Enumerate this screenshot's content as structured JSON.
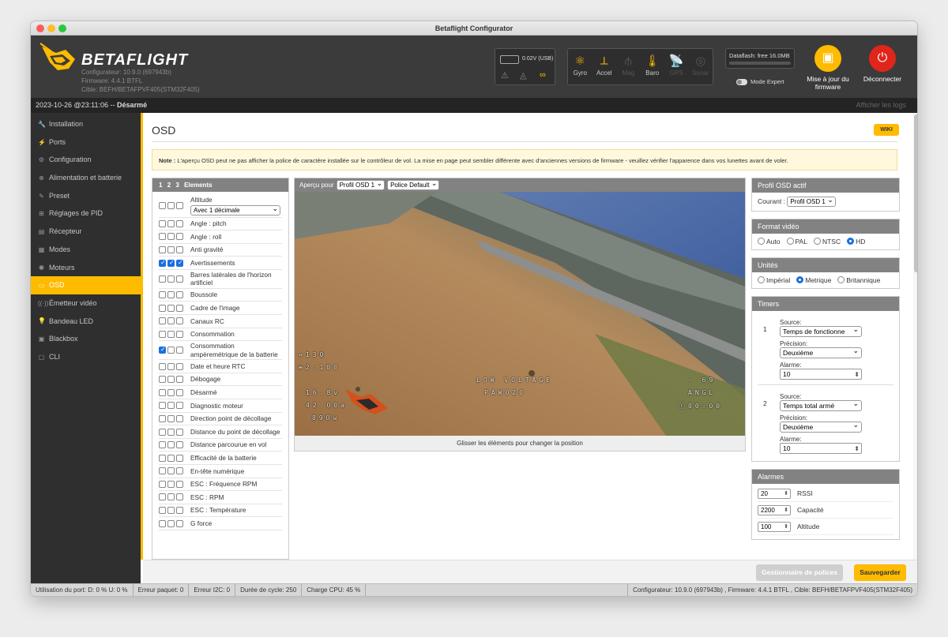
{
  "window": {
    "title": "Betaflight Configurator"
  },
  "header": {
    "brand": "BETAFLIGHT",
    "configurator_version": "Configurateur: 10.9.0 (697943b)",
    "firmware": "Firmware: 4.4.1 BTFL",
    "target": "Cible: BEFH/BETAFPVF405(STM32F405)",
    "battery_voltage": "0.02V (USB)",
    "sensors": [
      {
        "label": "Gyro",
        "icon": "gyro-icon",
        "active": true
      },
      {
        "label": "Accel",
        "icon": "accel-icon",
        "active": true
      },
      {
        "label": "Mag",
        "icon": "mag-icon",
        "active": false
      },
      {
        "label": "Baro",
        "icon": "baro-icon",
        "active": true
      },
      {
        "label": "GPS",
        "icon": "gps-icon",
        "active": false
      },
      {
        "label": "Sonar",
        "icon": "sonar-icon",
        "active": false
      }
    ],
    "dataflash": "Dataflash: free 16.0MB",
    "expert_mode": "Mode Expert",
    "firmware_update_line1": "Mise à jour du",
    "firmware_update_line2": "firmware",
    "disconnect": "Déconnecter",
    "colors": {
      "accent": "#ffbb00",
      "disconnect": "#e0261b"
    }
  },
  "status": {
    "datetime": "2023-10-26 @23:11:06 -- ",
    "state": "Désarmé",
    "show_logs": "Afficher les logs"
  },
  "sidebar": {
    "items": [
      {
        "label": "Installation",
        "icon": "wrench-icon"
      },
      {
        "label": "Ports",
        "icon": "plug-icon"
      },
      {
        "label": "Configuration",
        "icon": "gear-icon"
      },
      {
        "label": "Alimentation et batterie",
        "icon": "power-icon"
      },
      {
        "label": "Preset",
        "icon": "preset-icon"
      },
      {
        "label": "Réglages de PID",
        "icon": "pid-icon"
      },
      {
        "label": "Récepteur",
        "icon": "receiver-icon"
      },
      {
        "label": "Modes",
        "icon": "modes-icon"
      },
      {
        "label": "Moteurs",
        "icon": "motor-icon"
      },
      {
        "label": "OSD",
        "icon": "osd-icon",
        "active": true
      },
      {
        "label": "Émetteur vidéo",
        "icon": "vtx-icon"
      },
      {
        "label": "Bandeau LED",
        "icon": "led-icon"
      },
      {
        "label": "Blackbox",
        "icon": "blackbox-icon"
      },
      {
        "label": "CLI",
        "icon": "cli-icon"
      }
    ]
  },
  "page": {
    "title": "OSD",
    "wiki": "WIKI",
    "note_bold": "Note :",
    "note_text": " L'aperçu OSD peut ne pas afficher la police de caractère installée sur le contrôleur de vol. La mise en page peut sembler différente avec d'anciennes versions de firmware - veuillez vérifier l'apparence dans vos lunettes avant de voler."
  },
  "elements": {
    "header_nums": [
      "1",
      "2",
      "3"
    ],
    "header_label": "Elements",
    "altitude_option": "Avec 1 décimale",
    "items": [
      {
        "label": "Altitude",
        "checks": [
          false,
          false,
          false
        ],
        "has_select": true
      },
      {
        "label": "Angle : pitch",
        "checks": [
          false,
          false,
          false
        ]
      },
      {
        "label": "Angle : roll",
        "checks": [
          false,
          false,
          false
        ]
      },
      {
        "label": "Anti gravité",
        "checks": [
          false,
          false,
          false
        ]
      },
      {
        "label": "Avertissements",
        "checks": [
          true,
          true,
          true
        ]
      },
      {
        "label": "Barres latérales de l'horizon artificiel",
        "checks": [
          false,
          false,
          false
        ]
      },
      {
        "label": "Boussole",
        "checks": [
          false,
          false,
          false
        ]
      },
      {
        "label": "Cadre de l'image",
        "checks": [
          false,
          false,
          false
        ]
      },
      {
        "label": "Canaux RC",
        "checks": [
          false,
          false,
          false
        ]
      },
      {
        "label": "Consommation",
        "checks": [
          false,
          false,
          false
        ]
      },
      {
        "label": "Consommation ampèremétrique de la batterie",
        "checks": [
          true,
          false,
          false
        ]
      },
      {
        "label": "Date et heure RTC",
        "checks": [
          false,
          false,
          false
        ]
      },
      {
        "label": "Débogage",
        "checks": [
          false,
          false,
          false
        ]
      },
      {
        "label": "Désarmé",
        "checks": [
          false,
          false,
          false
        ]
      },
      {
        "label": "Diagnostic moteur",
        "checks": [
          false,
          false,
          false
        ]
      },
      {
        "label": "Direction point de décollage",
        "checks": [
          false,
          false,
          false
        ]
      },
      {
        "label": "Distance du point de décollage",
        "checks": [
          false,
          false,
          false
        ]
      },
      {
        "label": "Distance parcourue en vol",
        "checks": [
          false,
          false,
          false
        ]
      },
      {
        "label": "Efficacité de la batterie",
        "checks": [
          false,
          false,
          false
        ]
      },
      {
        "label": "En-tête numérique",
        "checks": [
          false,
          false,
          false
        ]
      },
      {
        "label": "ESC : Fréquence RPM",
        "checks": [
          false,
          false,
          false
        ]
      },
      {
        "label": "ESC : RPM",
        "checks": [
          false,
          false,
          false
        ]
      },
      {
        "label": "ESC : Température",
        "checks": [
          false,
          false,
          false
        ]
      },
      {
        "label": "G force",
        "checks": [
          false,
          false,
          false
        ]
      }
    ]
  },
  "preview": {
    "label": "Aperçu pour",
    "profile": "Profil OSD 1",
    "font": "Police Default",
    "drag_hint": "Glisser les éléments pour changer la position",
    "osd": {
      "alt": "↔130",
      "time": "≡2:100",
      "batt": "16.8v",
      "mah": "42.00a",
      "watts": "890w",
      "warn1": "LOW VOLTAGE",
      "warn2": "PAW020",
      "right1": "· 69",
      "right2": "ANGL",
      "right3": "ⓣ00:00"
    }
  },
  "right": {
    "profile": {
      "title": "Profil OSD actif",
      "label": "Courant :",
      "value": "Profil OSD 1"
    },
    "video": {
      "title": "Format vidéo",
      "options": [
        "Auto",
        "PAL",
        "NTSC",
        "HD"
      ],
      "selected": "HD"
    },
    "units": {
      "title": "Unités",
      "options": [
        "Impérial",
        "Metrique",
        "Britannique"
      ],
      "selected": "Metrique"
    },
    "timers": {
      "title": "Timers",
      "source_label": "Source:",
      "precision_label": "Précision:",
      "alarm_label": "Alarme:",
      "items": [
        {
          "num": "1",
          "source": "Temps de fonctionne",
          "precision": "Deuxième",
          "alarm": "10"
        },
        {
          "num": "2",
          "source": "Temps total armé",
          "precision": "Deuxième",
          "alarm": "10"
        }
      ]
    },
    "alarms": {
      "title": "Alarmes",
      "items": [
        {
          "value": "20",
          "label": "RSSI"
        },
        {
          "value": "2200",
          "label": "Capacité"
        },
        {
          "value": "100",
          "label": "Altitude"
        }
      ]
    }
  },
  "footer": {
    "font_manager": "Gestionnaire de polices",
    "save": "Sauvegarder"
  },
  "bottom": {
    "port": "Utilisation du port: D: 0 % U: 0 %",
    "packet": "Erreur paquet: 0",
    "i2c": "Erreur I2C: 0",
    "cycle": "Durée de cycle: 250",
    "cpu": "Charge CPU: 45 %",
    "versions": "Configurateur: 10.9.0 (697943b) , Firmware: 4.4.1 BTFL , Cible: BEFH/BETAFPVF405(STM32F405)"
  }
}
